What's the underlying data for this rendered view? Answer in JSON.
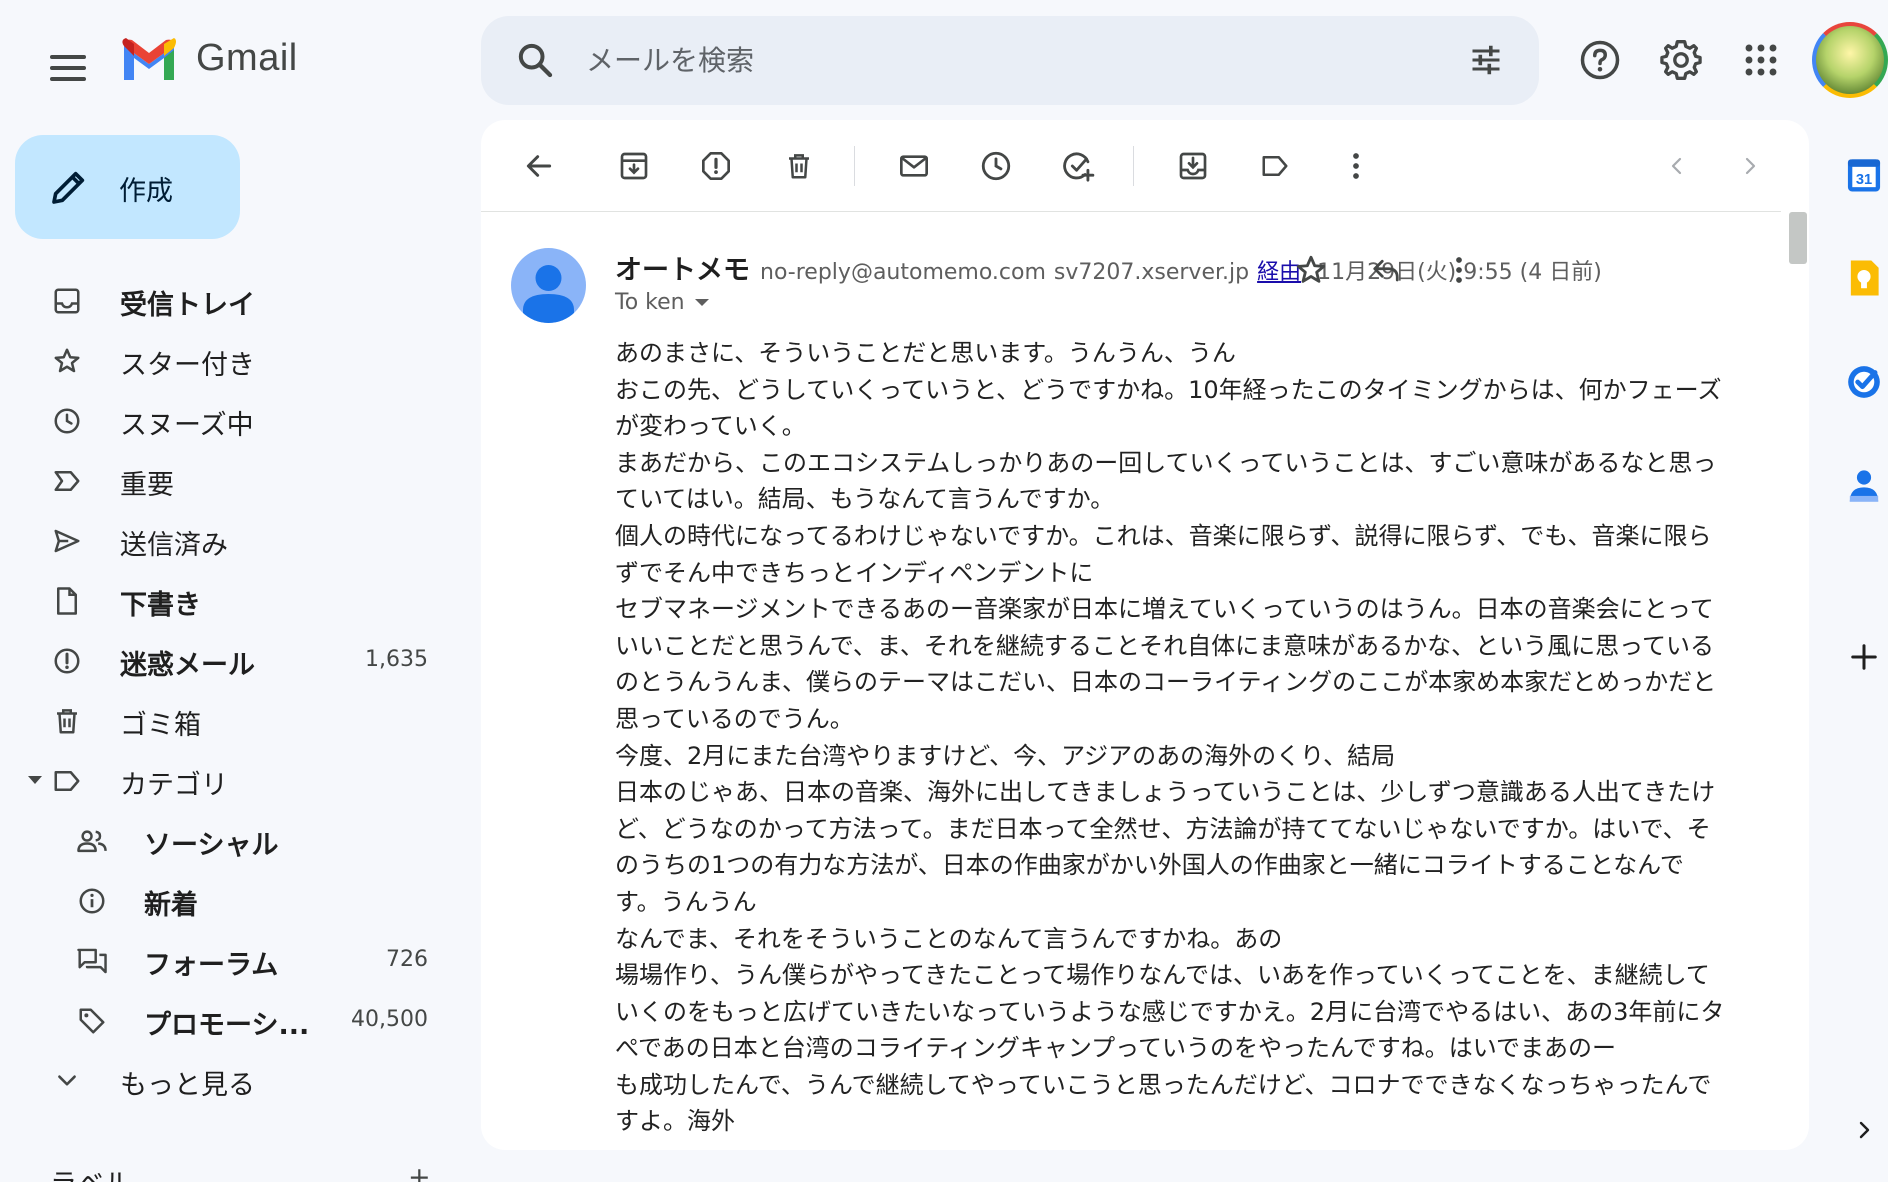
{
  "app": {
    "name": "Gmail"
  },
  "search": {
    "placeholder": "メールを検索"
  },
  "compose": {
    "label": "作成"
  },
  "nav": {
    "items": [
      {
        "label": "受信トレイ",
        "count": ""
      },
      {
        "label": "スター付き",
        "count": ""
      },
      {
        "label": "スヌーズ中",
        "count": ""
      },
      {
        "label": "重要",
        "count": ""
      },
      {
        "label": "送信済み",
        "count": ""
      },
      {
        "label": "下書き",
        "count": ""
      },
      {
        "label": "迷惑メール",
        "count": "1,635"
      },
      {
        "label": "ゴミ箱",
        "count": ""
      },
      {
        "label": "カテゴリ",
        "count": ""
      },
      {
        "label": "ソーシャル",
        "count": ""
      },
      {
        "label": "新着",
        "count": ""
      },
      {
        "label": "フォーラム",
        "count": "726"
      },
      {
        "label": "プロモーシ...",
        "count": "40,500"
      },
      {
        "label": "もっと見る",
        "count": ""
      }
    ],
    "labels_heading": "ラベル"
  },
  "email": {
    "sender_name": "オートメモ",
    "sender_email": "no-reply@automemo.com",
    "via_domain": "sv7207.xserver.jp",
    "via_label": "経由",
    "date": "11月29日(火) 9:55 (4 日前)",
    "to": "To ken",
    "body_lines": [
      "あのまさに、そういうことだと思います。うんうん、うん",
      "おこの先、どうしていくっていうと、どうですかね。10年経ったこのタイミングからは、何かフェーズ",
      "が変わっていく。",
      "まあだから、このエコシステムしっかりあのー回していくっていうことは、すごい意味があるなと思っ",
      "ていてはい。結局、もうなんて言うんですか。",
      "個人の時代になってるわけじゃないですか。これは、音楽に限らず、説得に限らず、でも、音楽に限ら",
      "ずでそん中できちっとインディペンデントに",
      "セブマネージメントできるあのー音楽家が日本に増えていくっていうのはうん。日本の音楽会にとって",
      "いいことだと思うんで、ま、それを継続することそれ自体にま意味があるかな、という風に思っている",
      "のとうんうんま、僕らのテーマはこだい、日本のコーライティングのここが本家め本家だとめっかだと",
      "思っているのでうん。",
      "今度、2月にまた台湾やりますけど、今、アジアのあの海外のくり、結局",
      "日本のじゃあ、日本の音楽、海外に出してきましょうっていうことは、少しずつ意識ある人出てきたけ",
      "ど、どうなのかって方法って。まだ日本って全然せ、方法論が持ててないじゃないですか。はいで、そ",
      "のうちの1つの有力な方法が、日本の作曲家がかい外国人の作曲家と一緒にコライトすることなんで",
      "す。うんうん",
      "なんでま、それをそういうことのなんて言うんですかね。あの",
      "場場作り、うん僕らがやってきたことって場作りなんでは、いあを作っていくってことを、ま継続して",
      "いくのをもっと広げていきたいなっていうような感じですかえ。2月に台湾でやるはい、あの3年前にタ",
      "ぺであの日本と台湾のコライティングキャンプっていうのをやったんですね。はいでまあのー",
      "も成功したんで、うんで継続してやっていこうと思ったんだけど、コロナでできなくなっちゃったんで",
      "すよ。海外"
    ]
  },
  "side_panel": {
    "calendar_day": "31"
  }
}
